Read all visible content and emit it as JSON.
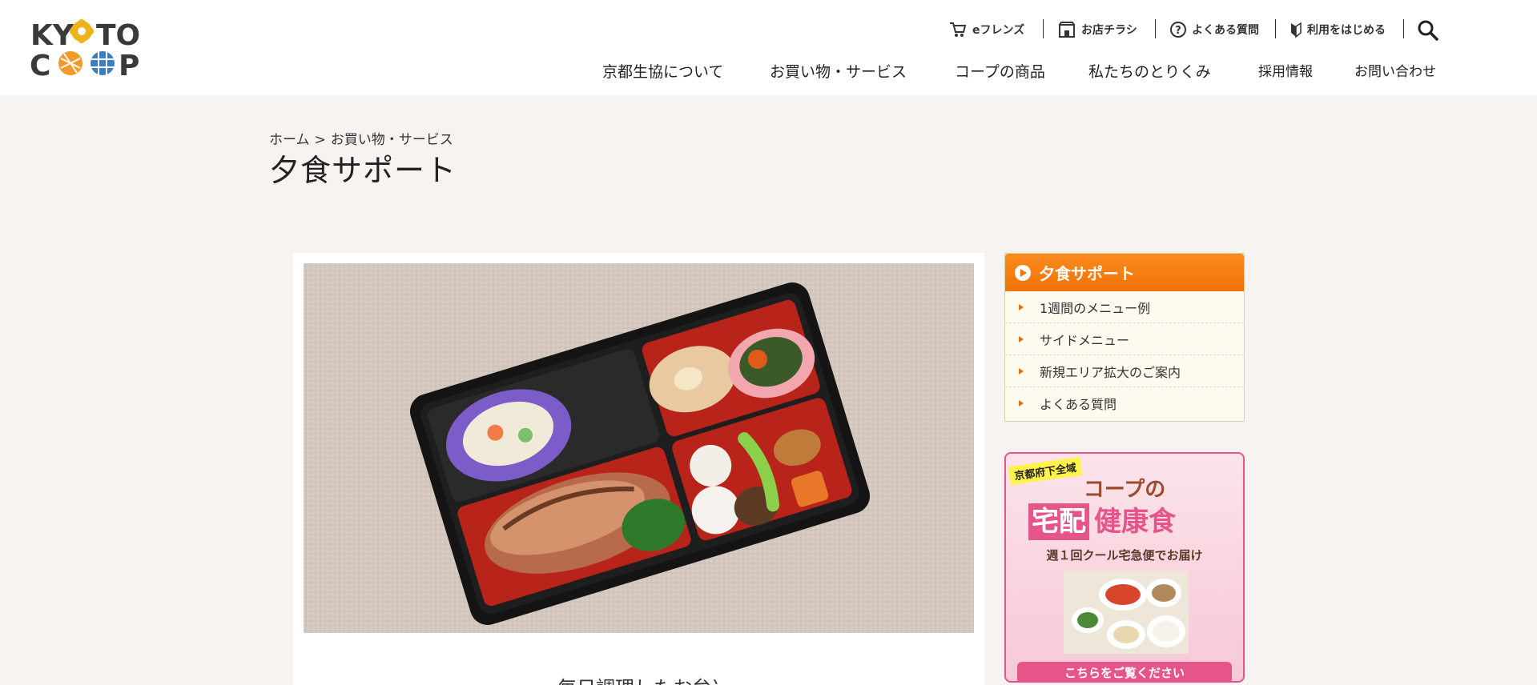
{
  "header": {
    "logo_text": "KYOTO COOP",
    "top_links": [
      {
        "label": "eフレンズ",
        "icon": "cart-icon"
      },
      {
        "label": "お店チラシ",
        "icon": "store-icon"
      },
      {
        "label": "よくある質問",
        "icon": "question-icon"
      },
      {
        "label": "利用をはじめる",
        "icon": "beginner-mark-icon"
      }
    ],
    "search_icon": "search-icon",
    "nav": [
      "京都生協について",
      "お買い物・サービス",
      "コープの商品",
      "私たちのとりくみ",
      "採用情報",
      "お問い合わせ"
    ]
  },
  "breadcrumb": {
    "home": "ホーム",
    "separator": ">",
    "current": "お買い物・サービス"
  },
  "page_title": "夕食サポート",
  "main": {
    "image_alt": "bento-photo",
    "partial_heading": "毎日調理したお弁当"
  },
  "side_menu": {
    "title": "夕食サポート",
    "items": [
      "1週間のメニュー例",
      "サイドメニュー",
      "新規エリア拡大のご案内",
      "よくある質問"
    ]
  },
  "banner": {
    "tag": "京都府下全域",
    "line1": "コープの",
    "line2_box": "宅配",
    "line2_plain": "健康食",
    "line3": "週１回クール宅急便でお届け",
    "cta": "こちらをご覧ください"
  },
  "colors": {
    "accent_orange": "#f27307",
    "banner_pink": "#e6558a",
    "bg": "#f6f3f0"
  }
}
